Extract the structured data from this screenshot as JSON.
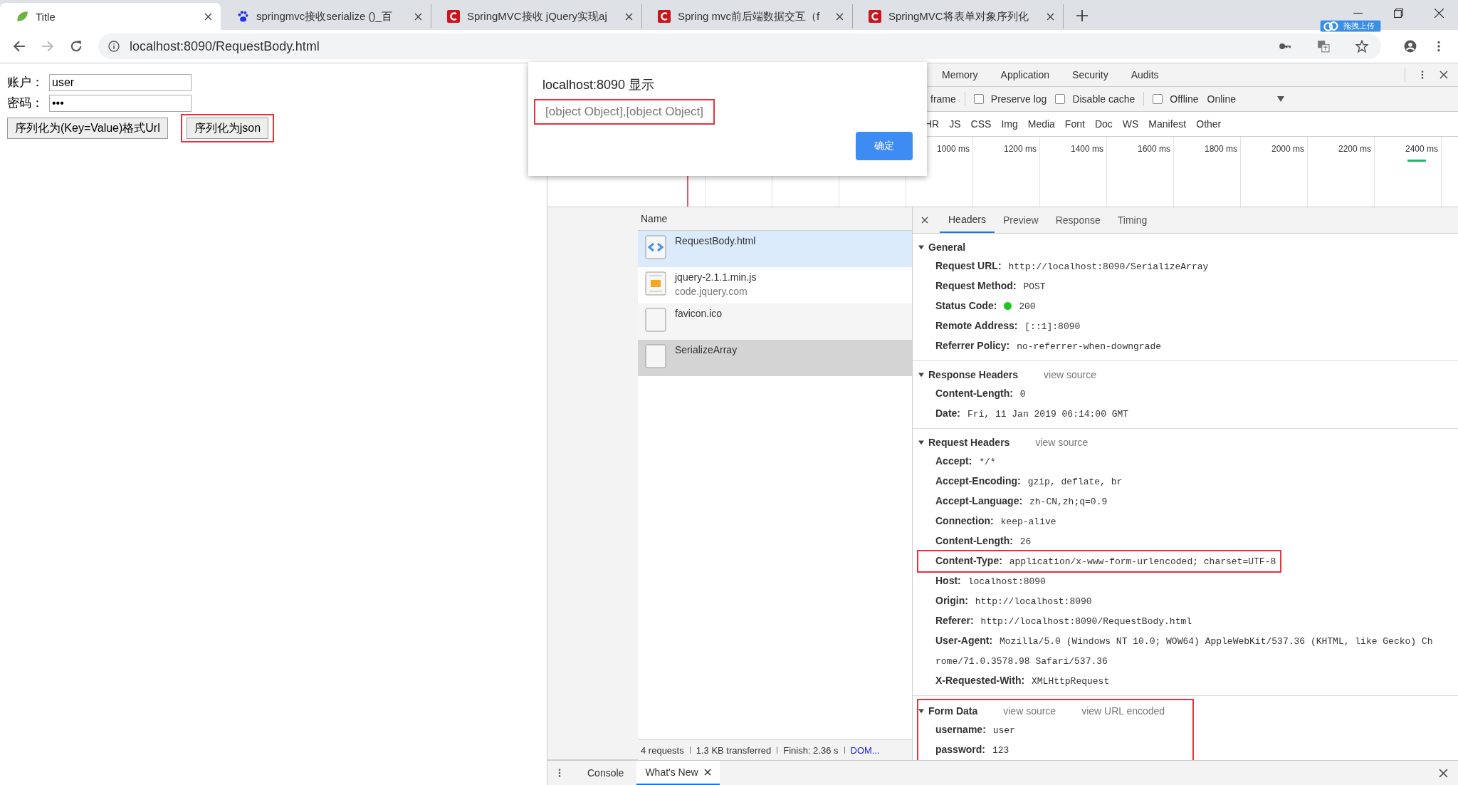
{
  "browser": {
    "tabs": [
      {
        "title": "Title",
        "kind": "leaf",
        "selected": true
      },
      {
        "title": "springmvc接收serialize ()_百",
        "kind": "paw",
        "selected": false
      },
      {
        "title": "SpringMVC接收 jQuery实现aj",
        "kind": "c",
        "selected": false
      },
      {
        "title": "Spring mvc前后端数据交互（f",
        "kind": "c",
        "selected": false
      },
      {
        "title": "SpringMVC将表单对象序列化",
        "kind": "c",
        "selected": false
      }
    ],
    "extension_badge": "拖拽上传",
    "url": "localhost:8090/RequestBody.html"
  },
  "page": {
    "fields": [
      {
        "label": "账户：",
        "value": "user"
      },
      {
        "label": "密码：",
        "value": "•••"
      }
    ],
    "buttons": [
      {
        "label": "序列化为(Key=Value)格式Url",
        "highlighted": false
      },
      {
        "label": "序列化为json",
        "highlighted": true
      }
    ]
  },
  "dialog": {
    "title": "localhost:8090 显示",
    "message": "[object Object],[object Object]",
    "message_highlighted": true,
    "button": "确定"
  },
  "devtools": {
    "tabs": [
      "Memory",
      "Application",
      "Security",
      "Audits"
    ],
    "filter_row": {
      "cut_label": "frame",
      "checkboxes": [
        {
          "label": "Preserve log",
          "checked": false
        },
        {
          "label": "Disable cache",
          "checked": false
        },
        {
          "label": "Offline",
          "checked": false
        }
      ],
      "throttle": "Online"
    },
    "type_filters": [
      "HR",
      "JS",
      "CSS",
      "Img",
      "Media",
      "Font",
      "Doc",
      "WS",
      "Manifest",
      "Other"
    ],
    "timeline_labels": [
      "1000 ms",
      "1200 ms",
      "1400 ms",
      "1600 ms",
      "1800 ms",
      "2000 ms",
      "2200 ms",
      "2400 ms"
    ],
    "network": {
      "column": "Name",
      "rows": [
        {
          "name": "RequestBody.html",
          "kind": "html",
          "hovered": true,
          "selected": false
        },
        {
          "name": "jquery-2.1.1.min.js",
          "domain": "code.jquery.com",
          "kind": "js",
          "hovered": false,
          "selected": false
        },
        {
          "name": "favicon.ico",
          "kind": "blank",
          "hovered": false,
          "selected": false
        },
        {
          "name": "SerializeArray",
          "kind": "blank",
          "hovered": false,
          "selected": true
        }
      ],
      "summary": [
        "4 requests",
        "1.3 KB transferred",
        "Finish: 2.36 s"
      ],
      "summary_link": "DOM..."
    },
    "detail_tabs": [
      {
        "label": "Headers",
        "selected": true
      },
      {
        "label": "Preview",
        "selected": false
      },
      {
        "label": "Response",
        "selected": false
      },
      {
        "label": "Timing",
        "selected": false
      }
    ],
    "sections": [
      {
        "title": "General",
        "expanded": true,
        "highlighted": false,
        "rows": [
          {
            "name": "Request URL:",
            "value": "http://localhost:8090/SerializeArray",
            "kind": "text",
            "highlighted": false
          },
          {
            "name": "Request Method:",
            "value": "POST",
            "kind": "text",
            "highlighted": false
          },
          {
            "name": "Status Code:",
            "value": "200",
            "kind": "status",
            "highlighted": false
          },
          {
            "name": "Remote Address:",
            "value": "[::1]:8090",
            "kind": "text",
            "highlighted": false
          },
          {
            "name": "Referrer Policy:",
            "value": "no-referrer-when-downgrade",
            "kind": "text",
            "highlighted": false
          }
        ]
      },
      {
        "title": "Response Headers",
        "expanded": true,
        "highlighted": false,
        "links": [
          "view source"
        ],
        "rows": [
          {
            "name": "Content-Length:",
            "value": "0",
            "kind": "text",
            "highlighted": false
          },
          {
            "name": "Date:",
            "value": "Fri, 11 Jan 2019 06:14:00 GMT",
            "kind": "text",
            "highlighted": false
          }
        ]
      },
      {
        "title": "Request Headers",
        "expanded": true,
        "highlighted": false,
        "links": [
          "view source"
        ],
        "rows": [
          {
            "name": "Accept:",
            "value": "*/*",
            "kind": "text",
            "highlighted": false
          },
          {
            "name": "Accept-Encoding:",
            "value": "gzip, deflate, br",
            "kind": "text",
            "highlighted": false
          },
          {
            "name": "Accept-Language:",
            "value": "zh-CN,zh;q=0.9",
            "kind": "text",
            "highlighted": false
          },
          {
            "name": "Connection:",
            "value": "keep-alive",
            "kind": "text",
            "highlighted": false
          },
          {
            "name": "Content-Length:",
            "value": "26",
            "kind": "text",
            "highlighted": false
          },
          {
            "name": "Content-Type:",
            "value": "application/x-www-form-urlencoded; charset=UTF-8",
            "kind": "text",
            "highlighted": true
          },
          {
            "name": "Host:",
            "value": "localhost:8090",
            "kind": "text",
            "highlighted": false
          },
          {
            "name": "Origin:",
            "value": "http://localhost:8090",
            "kind": "text",
            "highlighted": false
          },
          {
            "name": "Referer:",
            "value": "http://localhost:8090/RequestBody.html",
            "kind": "text",
            "highlighted": false
          },
          {
            "name": "User-Agent:",
            "value": "Mozilla/5.0 (Windows NT 10.0; WOW64) AppleWebKit/537.36 (KHTML, like Gecko) Chrome/71.0.3578.98 Safari/537.36",
            "kind": "text",
            "highlighted": false
          },
          {
            "name": "X-Requested-With:",
            "value": "XMLHttpRequest",
            "kind": "text",
            "highlighted": false
          }
        ]
      },
      {
        "title": "Form Data",
        "expanded": true,
        "highlighted": true,
        "links": [
          "view source",
          "view URL encoded"
        ],
        "rows": [
          {
            "name": "username:",
            "value": "user",
            "kind": "text",
            "highlighted": false
          },
          {
            "name": "password:",
            "value": "123",
            "kind": "text",
            "highlighted": false
          }
        ]
      }
    ],
    "drawer_tabs": [
      {
        "label": "Console",
        "selected": false,
        "closable": false
      },
      {
        "label": "What's New",
        "selected": true,
        "closable": true
      }
    ]
  }
}
